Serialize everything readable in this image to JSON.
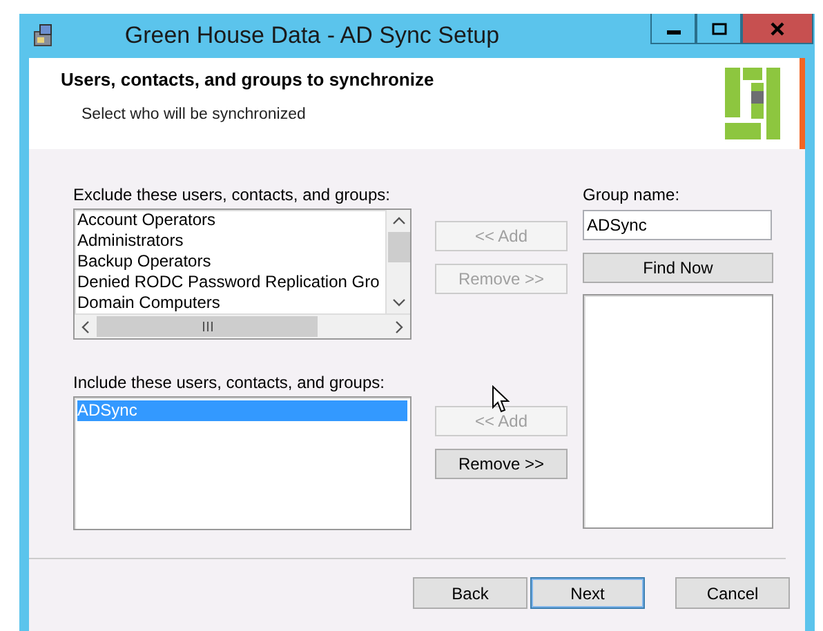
{
  "window": {
    "title": "Green House Data - AD Sync Setup"
  },
  "header": {
    "title": "Users, contacts, and groups to synchronize",
    "subtitle": "Select who will be synchronized"
  },
  "exclude": {
    "label": "Exclude these users, contacts, and groups:",
    "items": [
      {
        "text": "Account Operators",
        "selected": false
      },
      {
        "text": "Administrators",
        "selected": false
      },
      {
        "text": "Backup Operators",
        "selected": false
      },
      {
        "text": "Denied RODC Password Replication Gro",
        "selected": false
      },
      {
        "text": "Domain Computers",
        "selected": false
      }
    ]
  },
  "include": {
    "label": "Include these users, contacts, and groups:",
    "items": [
      {
        "text": "ADSync",
        "selected": true
      }
    ]
  },
  "exclude_buttons": [
    {
      "label": "<< Add",
      "disabled": true
    },
    {
      "label": "Remove >>",
      "disabled": true
    }
  ],
  "include_buttons": [
    {
      "label": "<< Add",
      "disabled": true
    },
    {
      "label": "Remove >>",
      "disabled": false
    }
  ],
  "group": {
    "label": "Group name:",
    "value": "ADSync",
    "find_button": "Find Now"
  },
  "footer_buttons": [
    {
      "label": "Back",
      "default": false
    },
    {
      "label": "Next",
      "default": true
    },
    {
      "label": "Cancel",
      "default": false
    }
  ]
}
